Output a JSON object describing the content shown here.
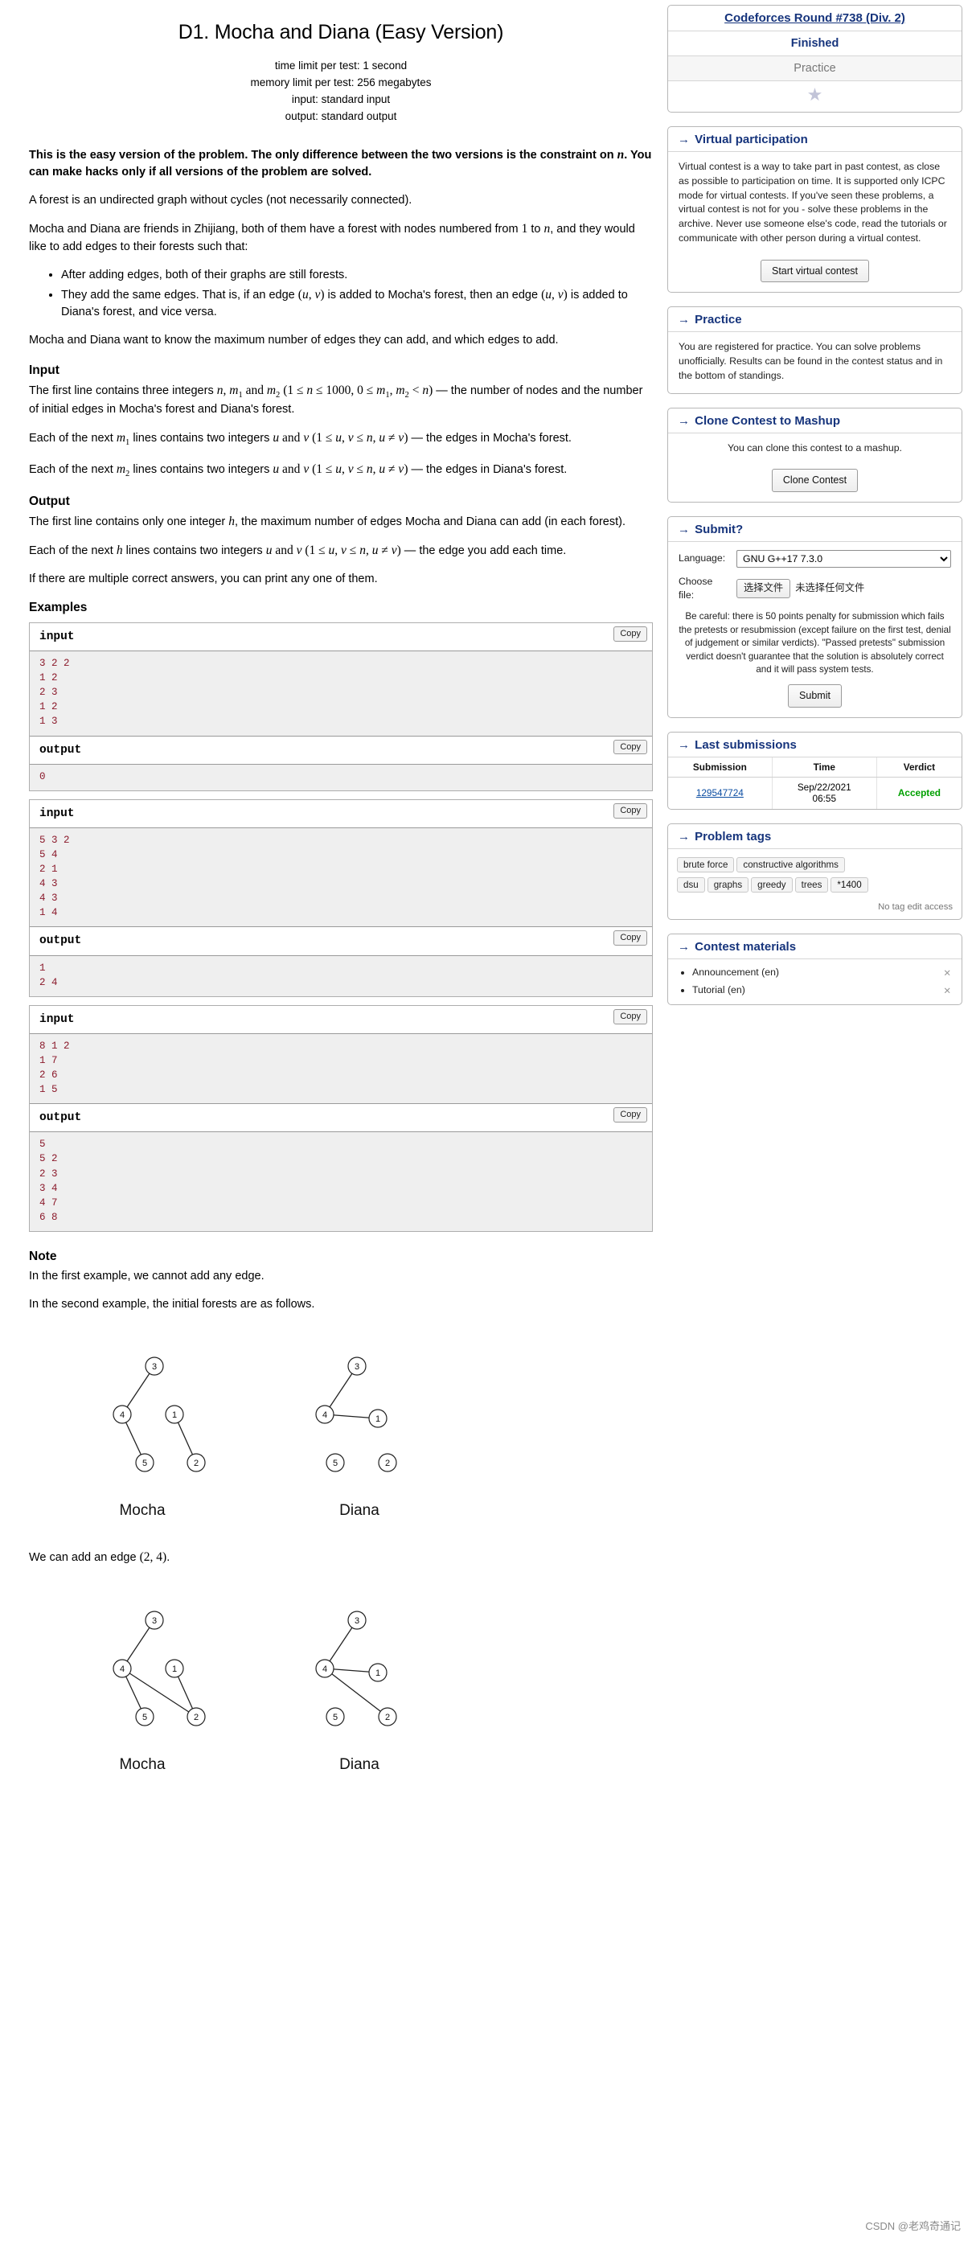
{
  "problem": {
    "title": "D1. Mocha and Diana (Easy Version)",
    "limits": {
      "time": "time limit per test: 1 second",
      "memory": "memory limit per test: 256 megabytes",
      "input": "input: standard input",
      "output": "output: standard output"
    },
    "paragraphs": {
      "easy_version_note_a": "This is the easy version of the problem. The only difference between the two versions is the constraint on ",
      "easy_version_note_b": ". You can make hacks only if all versions of the problem are solved.",
      "forest_def": "A forest is an undirected graph without cycles (not necessarily connected).",
      "intro_a": "Mocha and Diana are friends in Zhijiang, both of them have a forest with nodes numbered from ",
      "intro_b": " to ",
      "intro_c": ", and they would like to add edges to their forests such that:",
      "bullet1": "After adding edges, both of their graphs are still forests.",
      "bullet2_a": "They add the same edges. That is, if an edge ",
      "bullet2_b": " is added to Mocha's forest, then an edge ",
      "bullet2_c": " is added to Diana's forest, and vice versa.",
      "goal": "Mocha and Diana want to know the maximum number of edges they can add, and which edges to add."
    },
    "input_section": {
      "heading": "Input",
      "p1_a": "The first line contains three integers ",
      "p1_b": " — the number of nodes and the number of initial edges in Mocha's forest and Diana's forest.",
      "p2_a": "Each of the next ",
      "p2_b": " lines contains two integers ",
      "p2_c": " — the edges in Mocha's forest.",
      "p3_c": " — the edges in Diana's forest."
    },
    "output_section": {
      "heading": "Output",
      "p1_a": "The first line contains only one integer ",
      "p1_b": ", the maximum number of edges Mocha and Diana can add (in each forest).",
      "p2_a": "Each of the next ",
      "p2_b": " lines contains two integers ",
      "p2_c": " — the edge you add each time.",
      "p3": "If there are multiple correct answers, you can print any one of them."
    },
    "examples_heading": "Examples",
    "copy_label": "Copy",
    "input_label": "input",
    "output_label": "output",
    "examples": [
      {
        "input": "3 2 2\n1 2\n2 3\n1 2\n1 3",
        "output": "0"
      },
      {
        "input": "5 3 2\n5 4\n2 1\n4 3\n4 3\n1 4",
        "output": "1\n2 4"
      },
      {
        "input": "8 1 2\n1 7\n2 6\n1 5",
        "output": "5\n5 2\n2 3\n3 4\n4 7\n6 8"
      }
    ],
    "note": {
      "heading": "Note",
      "line1": "In the first example, we cannot add any edge.",
      "line2": "In the second example, the initial forests are as follows.",
      "line3_a": "We can add an edge ",
      "line3_b": "."
    },
    "figures": {
      "mocha_label": "Mocha",
      "diana_label": "Diana",
      "nodes": [
        "1",
        "2",
        "3",
        "4",
        "5"
      ]
    }
  },
  "sidebar": {
    "contest": {
      "name": "Codeforces Round #738 (Div. 2)",
      "status": "Finished",
      "phase": "Practice",
      "star_icon": "star-icon"
    },
    "virtual": {
      "caption": "Virtual participation",
      "body": "Virtual contest is a way to take part in past contest, as close as possible to participation on time. It is supported only ICPC mode for virtual contests. If you've seen these problems, a virtual contest is not for you - solve these problems in the archive. Never use someone else's code, read the tutorials or communicate with other person during a virtual contest.",
      "button": "Start virtual contest"
    },
    "practice": {
      "caption": "Practice",
      "body": "You are registered for practice. You can solve problems unofficially. Results can be found in the contest status and in the bottom of standings."
    },
    "clone": {
      "caption": "Clone Contest to Mashup",
      "body": "You can clone this contest to a mashup.",
      "button": "Clone Contest"
    },
    "submit": {
      "caption": "Submit?",
      "language_label": "Language:",
      "language_value": "GNU G++17 7.3.0",
      "language_options": [
        "GNU G++17 7.3.0"
      ],
      "file_label_line1": "Choose",
      "file_label_line2": "file:",
      "file_button": "选择文件",
      "file_status": "未选择任何文件",
      "careful": "Be careful: there is 50 points penalty for submission which fails the pretests or resubmission (except failure on the first test, denial of judgement or similar verdicts). \"Passed pretests\" submission verdict doesn't guarantee that the solution is absolutely correct and it will pass system tests.",
      "submit_button": "Submit"
    },
    "last_submissions": {
      "caption": "Last submissions",
      "columns": [
        "Submission",
        "Time",
        "Verdict"
      ],
      "rows": [
        {
          "id": "129547724",
          "time_line1": "Sep/22/2021",
          "time_line2": "06:55",
          "verdict": "Accepted"
        }
      ]
    },
    "problem_tags": {
      "caption": "Problem tags",
      "tags": [
        "brute force",
        "constructive algorithms",
        "dsu",
        "graphs",
        "greedy",
        "trees",
        "*1400"
      ],
      "no_edit_access": "No tag edit access"
    },
    "contest_materials": {
      "caption": "Contest materials",
      "items": [
        "Announcement (en)",
        "Tutorial (en)"
      ],
      "remove_icon": "close-icon"
    }
  },
  "watermark": "CSDN @老鸡奇通记"
}
